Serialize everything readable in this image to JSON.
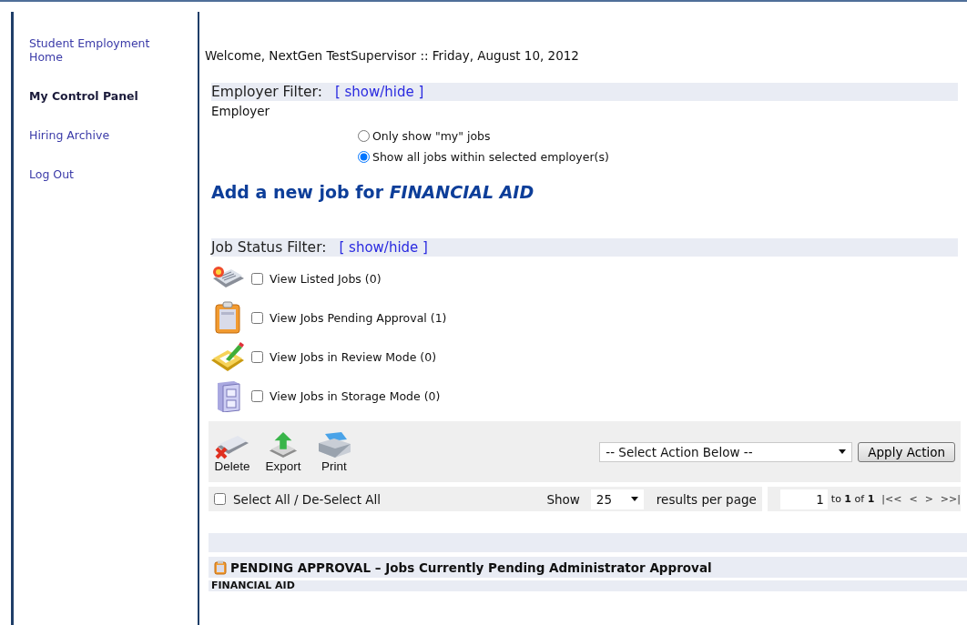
{
  "sidebar": {
    "items": [
      {
        "label": "Student Employment Home",
        "selected": false
      },
      {
        "label": "My Control Panel",
        "selected": true
      },
      {
        "label": "Hiring Archive",
        "selected": false
      },
      {
        "label": "Log Out",
        "selected": false
      }
    ]
  },
  "welcome": "Welcome, NextGen TestSupervisor :: Friday, August 10, 2012",
  "employer_filter": {
    "title": "Employer Filter:",
    "toggle": "[ show/hide ]",
    "label": "Employer",
    "options": [
      {
        "label": "Only show \"my\" jobs",
        "selected": false
      },
      {
        "label": "Show all jobs within selected employer(s)",
        "selected": true
      }
    ]
  },
  "add_job": {
    "text": "Add a new job for",
    "employer": "FINANCIAL AID"
  },
  "job_status_filter": {
    "title": "Job Status Filter:",
    "toggle": "[ show/hide ]",
    "items": [
      {
        "kind": "listed",
        "label": "View Listed Jobs (0)",
        "checked": false
      },
      {
        "kind": "pending",
        "label": "View Jobs Pending Approval (1)",
        "checked": false
      },
      {
        "kind": "review",
        "label": "View Jobs in Review Mode (0)",
        "checked": false
      },
      {
        "kind": "storage",
        "label": "View Jobs in Storage Mode (0)",
        "checked": false
      }
    ]
  },
  "toolbar": {
    "buttons": [
      {
        "kind": "delete",
        "label": "Delete"
      },
      {
        "kind": "export",
        "label": "Export"
      },
      {
        "kind": "print",
        "label": "Print"
      }
    ],
    "action_select": "-- Select Action Below --",
    "apply": "Apply Action"
  },
  "list_bar": {
    "select_all": {
      "label": "Select All / De-Select All",
      "checked": false
    },
    "show": "Show",
    "per_page": "25",
    "per_page_suffix": "results per page",
    "page": "1",
    "page_info": "to **1** of **1**",
    "nav": [
      "|<<",
      "<",
      ">",
      ">>|"
    ]
  },
  "section": {
    "title": "PENDING APPROVAL – Jobs Currently Pending Administrator Approval",
    "group": "FINANCIAL AID"
  }
}
